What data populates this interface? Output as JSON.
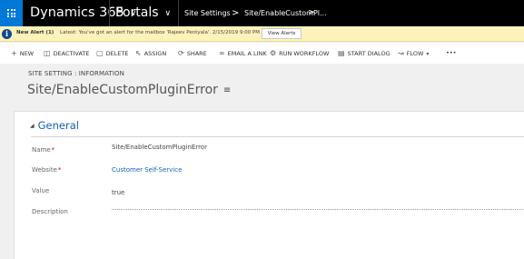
{
  "nav": {
    "app_name": "Dynamics 365",
    "area": "Portals",
    "breadcrumb_entity": "Site Settings",
    "breadcrumb_separator": ">",
    "breadcrumb_record": "Site/EnableCustomPl...",
    "record_chevron": ">"
  },
  "alert": {
    "title": "New Alert (1)",
    "message": "Latest: You've got an alert for the mailbox 'Rajeev Pentyala'. 2/15/2019 9:00 PM",
    "button_label": "View Alerts"
  },
  "commands": [
    {
      "label": "NEW",
      "icon": "plus-icon"
    },
    {
      "label": "DEACTIVATE",
      "icon": "deactivate-icon"
    },
    {
      "label": "DELETE",
      "icon": "trash-icon"
    },
    {
      "label": "ASSIGN",
      "icon": "assign-icon"
    },
    {
      "label": "SHARE",
      "icon": "share-icon"
    },
    {
      "label": "EMAIL A LINK",
      "icon": "link-icon"
    },
    {
      "label": "RUN WORKFLOW",
      "icon": "workflow-icon"
    },
    {
      "label": "START DIALOG",
      "icon": "dialog-icon"
    },
    {
      "label": "FLOW",
      "icon": "flow-icon"
    },
    {
      "label": "•••",
      "icon": "more-icon"
    }
  ],
  "header": {
    "entity_label": "SITE SETTING : INFORMATION",
    "record_title": "Site/EnableCustomPluginError"
  },
  "form": {
    "section_title": "General",
    "fields": [
      {
        "label": "Name",
        "required": "*",
        "value": "Site/EnableCustomPluginError"
      },
      {
        "label": "Website",
        "required": "*",
        "value": "Customer Self-Service"
      },
      {
        "label": "Value",
        "value": "true"
      },
      {
        "label": "Description",
        "value": ""
      }
    ]
  },
  "colors": {
    "nav_bg": "#000000",
    "waffle_bg": "#0078d7",
    "alert_bg": "#fdf3ba",
    "link": "#1160b7",
    "required": "#cc0000"
  }
}
